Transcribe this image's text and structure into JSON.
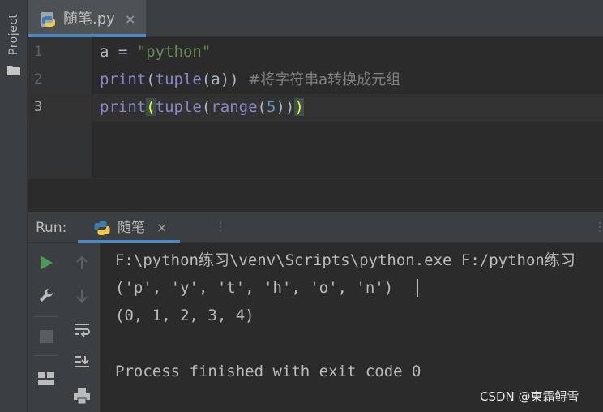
{
  "project_stripe": {
    "label": "Project",
    "icon": "folder-icon"
  },
  "editor_tab": {
    "filename": "随笔.py",
    "icon": "python-file-icon",
    "close": "×"
  },
  "editor": {
    "active_line": 3,
    "lines": [
      {
        "number": "1",
        "tokens": {
          "var": "a = ",
          "str": "\"python\""
        }
      },
      {
        "number": "2",
        "tokens": {
          "fn1": "print",
          "p1": "(",
          "fn2": "tuple",
          "rest": "(a)) ",
          "comment": "#将字符串a转换成元组"
        }
      },
      {
        "number": "3",
        "tokens": {
          "fn1": "print",
          "p1": "(",
          "fn2": "tuple",
          "p2": "(",
          "fn3": "range",
          "p3": "(",
          "num": "5",
          "p4": "))",
          "p5": ")"
        }
      }
    ]
  },
  "run_panel": {
    "label": "Run:",
    "tab_name": "随笔",
    "tab_icon": "python-icon",
    "tab_close": "×",
    "toolbar": {
      "rerun": "play-icon",
      "up": "arrow-up-icon",
      "settings": "wrench-icon",
      "down": "arrow-down-icon",
      "stop": "stop-icon",
      "soft_wrap": "soft-wrap-icon",
      "layout": "layout-icon",
      "scroll_end": "scroll-to-end-icon",
      "print": "print-icon"
    },
    "console": [
      "F:\\python练习\\venv\\Scripts\\python.exe F:/python练习",
      "('p', 'y', 't', 'h', 'o', 'n')",
      "(0, 1, 2, 3, 4)",
      "",
      "Process finished with exit code 0"
    ]
  },
  "watermark": "CSDN @東霜鲟雪",
  "colors": {
    "background": "#2b2b2b",
    "panel": "#3c3f41",
    "accent": "#4a88c7",
    "run_green": "#499c54",
    "string": "#6a8759",
    "builtin": "#8888c6",
    "number": "#6897bb",
    "comment": "#808080"
  }
}
